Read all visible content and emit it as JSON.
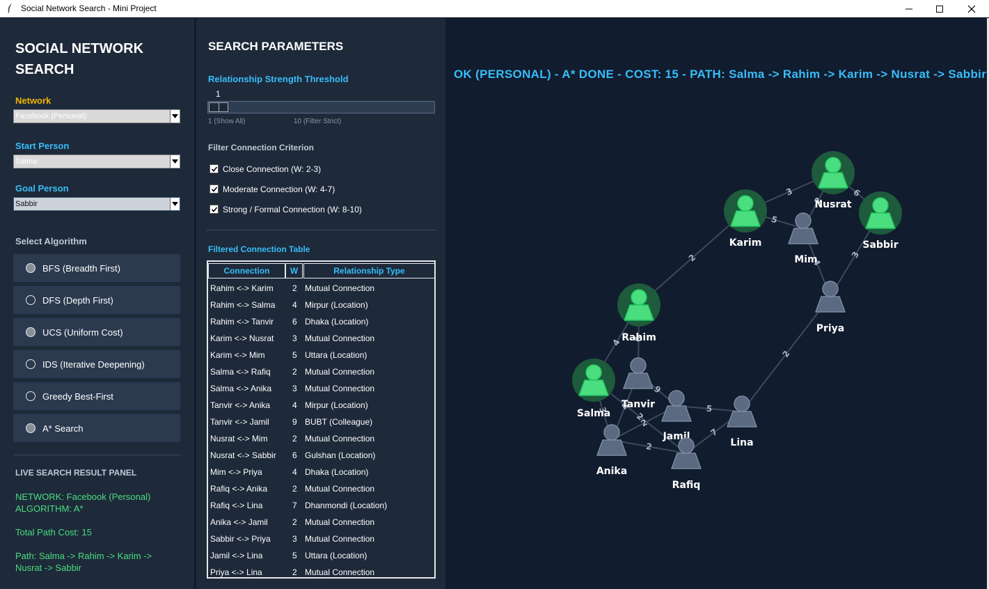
{
  "window": {
    "title": "Social Network Search - Mini Project"
  },
  "sidebar": {
    "title": "SOCIAL NETWORK SEARCH",
    "network": {
      "label": "Network",
      "value": "Facebook (Personal)"
    },
    "start": {
      "label": "Start Person",
      "value": "Salma"
    },
    "goal": {
      "label": "Goal Person",
      "value": "Sabbir"
    },
    "algo_label": "Select Algorithm",
    "algorithms": [
      {
        "label": "BFS (Breadth First)",
        "selected": true
      },
      {
        "label": "DFS (Depth First)",
        "selected": false
      },
      {
        "label": "UCS (Uniform Cost)",
        "selected": true
      },
      {
        "label": "IDS (Iterative Deepening)",
        "selected": false
      },
      {
        "label": "Greedy Best-First",
        "selected": false
      },
      {
        "label": "A* Search",
        "selected": true
      }
    ],
    "live": {
      "title": "LIVE SEARCH RESULT PANEL",
      "network_line": "NETWORK: Facebook (Personal)",
      "algo_line": "ALGORITHM: A*",
      "cost_line": "Total Path Cost: 15",
      "path_line": "Path: Salma -> Rahim -> Karim -> Nusrat -> Sabbir"
    }
  },
  "params": {
    "title": "SEARCH PARAMETERS",
    "threshold_label": "Relationship Strength Threshold",
    "threshold_value": "1",
    "threshold_fraction": 0.0,
    "min_caption": "1 (Show All)",
    "max_caption": "10 (Filter Strict)",
    "filter_label": "Filter Connection Criterion",
    "filters": [
      {
        "label": "Close Connection (W: 2-3)",
        "checked": true
      },
      {
        "label": "Moderate Connection (W: 4-7)",
        "checked": true
      },
      {
        "label": "Strong / Formal Connection (W: 8-10)",
        "checked": true
      }
    ],
    "table_title": "Filtered Connection Table",
    "table": {
      "headers": [
        "Connection",
        "W",
        "Relationship Type"
      ],
      "rows": [
        [
          "Rahim <-> Karim",
          "2",
          "Mutual Connection"
        ],
        [
          "Rahim <-> Salma",
          "4",
          "Mirpur (Location)"
        ],
        [
          "Rahim <-> Tanvir",
          "6",
          "Dhaka (Location)"
        ],
        [
          "Karim <-> Nusrat",
          "3",
          "Mutual Connection"
        ],
        [
          "Karim <-> Mim",
          "5",
          "Uttara (Location)"
        ],
        [
          "Salma <-> Rafiq",
          "2",
          "Mutual Connection"
        ],
        [
          "Salma <-> Anika",
          "3",
          "Mutual Connection"
        ],
        [
          "Tanvir <-> Anika",
          "4",
          "Mirpur (Location)"
        ],
        [
          "Tanvir <-> Jamil",
          "9",
          "BUBT (Colleague)"
        ],
        [
          "Nusrat <-> Mim",
          "2",
          "Mutual Connection"
        ],
        [
          "Nusrat <-> Sabbir",
          "6",
          "Gulshan (Location)"
        ],
        [
          "Mim <-> Priya",
          "4",
          "Dhaka (Location)"
        ],
        [
          "Rafiq <-> Anika",
          "2",
          "Mutual Connection"
        ],
        [
          "Rafiq <-> Lina",
          "7",
          "Dhanmondi (Location)"
        ],
        [
          "Anika <-> Jamil",
          "2",
          "Mutual Connection"
        ],
        [
          "Sabbir <-> Priya",
          "3",
          "Mutual Connection"
        ],
        [
          "Jamil <-> Lina",
          "5",
          "Uttara (Location)"
        ],
        [
          "Priya <-> Lina",
          "2",
          "Mutual Connection"
        ]
      ]
    }
  },
  "graph": {
    "banner": "OK (PERSONAL) - A* DONE  -  COST: 15  -  PATH: Salma -> Rahim -> Karim -> Nusrat -> Sabbir",
    "colors": {
      "path": "#4ade80",
      "path_halo": "#1e5a3c",
      "node": "#5b6a80",
      "edge": "#3e4a5c",
      "edge_label": "#aab3c0",
      "name": "#ffffff"
    },
    "nodes": [
      {
        "name": "Rahim",
        "on_path": true
      },
      {
        "name": "Karim",
        "on_path": true
      },
      {
        "name": "Nusrat",
        "on_path": true
      },
      {
        "name": "Sabbir",
        "on_path": true
      },
      {
        "name": "Salma",
        "on_path": true
      },
      {
        "name": "Mim",
        "on_path": false
      },
      {
        "name": "Priya",
        "on_path": false
      },
      {
        "name": "Tanvir",
        "on_path": false
      },
      {
        "name": "Jamil",
        "on_path": false
      },
      {
        "name": "Anika",
        "on_path": false
      },
      {
        "name": "Rafiq",
        "on_path": false
      },
      {
        "name": "Lina",
        "on_path": false
      }
    ],
    "edges": [
      {
        "a": "Rahim",
        "b": "Karim",
        "w": "2"
      },
      {
        "a": "Rahim",
        "b": "Salma",
        "w": "4"
      },
      {
        "a": "Rahim",
        "b": "Tanvir",
        "w": "6"
      },
      {
        "a": "Karim",
        "b": "Nusrat",
        "w": "3"
      },
      {
        "a": "Karim",
        "b": "Mim",
        "w": "5"
      },
      {
        "a": "Salma",
        "b": "Rafiq",
        "w": "2"
      },
      {
        "a": "Salma",
        "b": "Anika",
        "w": "3"
      },
      {
        "a": "Tanvir",
        "b": "Anika",
        "w": "4"
      },
      {
        "a": "Tanvir",
        "b": "Jamil",
        "w": "9"
      },
      {
        "a": "Nusrat",
        "b": "Mim",
        "w": "2"
      },
      {
        "a": "Nusrat",
        "b": "Sabbir",
        "w": "6"
      },
      {
        "a": "Mim",
        "b": "Priya",
        "w": "4"
      },
      {
        "a": "Rafiq",
        "b": "Anika",
        "w": "2"
      },
      {
        "a": "Rafiq",
        "b": "Lina",
        "w": "7"
      },
      {
        "a": "Anika",
        "b": "Jamil",
        "w": "2"
      },
      {
        "a": "Sabbir",
        "b": "Priya",
        "w": "3"
      },
      {
        "a": "Jamil",
        "b": "Lina",
        "w": "5"
      },
      {
        "a": "Priya",
        "b": "Lina",
        "w": "2"
      }
    ]
  }
}
